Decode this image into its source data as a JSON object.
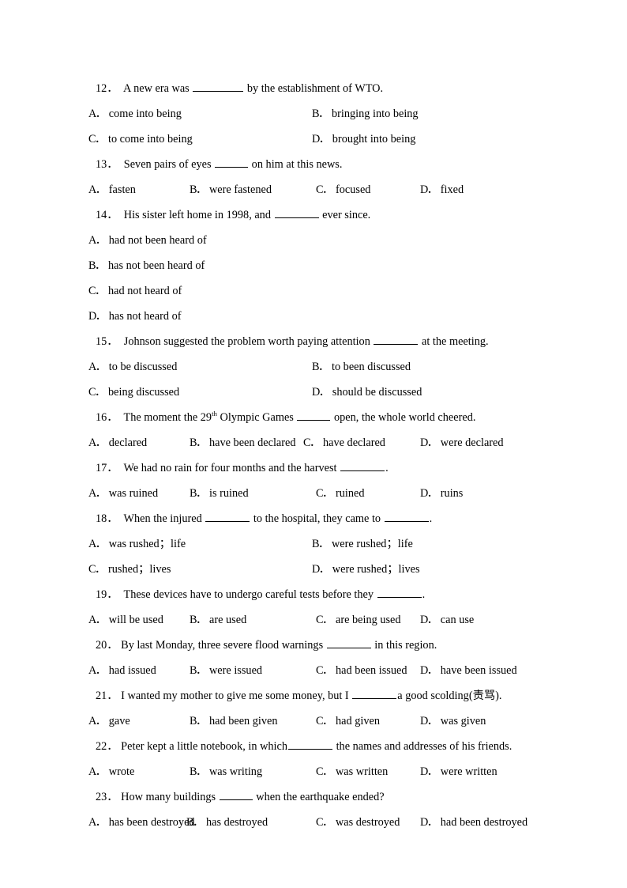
{
  "document": {
    "type": "english-grammar-worksheet",
    "page_background": "#ffffff",
    "text_color": "#000000"
  },
  "questions": [
    {
      "number": "12．",
      "stem_before": "A new era was ",
      "blank": "lg",
      "stem_after": " by the establishment of WTO.",
      "layout": "two",
      "options": [
        {
          "letter": "A．",
          "text": "come into being"
        },
        {
          "letter": "B．",
          "text": "bringing into being"
        },
        {
          "letter": "C．",
          "text": "to come into being"
        },
        {
          "letter": "D．",
          "text": "brought into being"
        }
      ]
    },
    {
      "number": "13．",
      "stem_before": "Seven pairs of eyes ",
      "blank": "sm",
      "stem_after": " on him at this news.",
      "layout": "four",
      "options": [
        {
          "letter": "A．",
          "text": "fasten"
        },
        {
          "letter": "B．",
          "text": "were fastened"
        },
        {
          "letter": "C．",
          "text": "focused"
        },
        {
          "letter": "D．",
          "text": "fixed"
        }
      ]
    },
    {
      "number": "14．",
      "stem_before": "His sister left home in 1998, and ",
      "blank": "md",
      "stem_after": " ever since.",
      "layout": "one",
      "options": [
        {
          "letter": "A．",
          "text": "had not been heard of"
        },
        {
          "letter": "B．",
          "text": "has not been heard of"
        },
        {
          "letter": "C．",
          "text": "had not heard of"
        },
        {
          "letter": "D．",
          "text": "has not heard of"
        }
      ]
    },
    {
      "number": "15．",
      "stem_before": "Johnson suggested the problem worth paying attention ",
      "blank": "md",
      "stem_after": " at the meeting.",
      "layout": "two",
      "options": [
        {
          "letter": "A．",
          "text": "to be discussed"
        },
        {
          "letter": "B．",
          "text": "to been discussed"
        },
        {
          "letter": "C．",
          "text": "being discussed"
        },
        {
          "letter": "D．",
          "text": "should be discussed"
        }
      ]
    },
    {
      "number": "16．",
      "stem_before": "The moment the 29",
      "superscript": "th",
      "stem_mid": " Olympic Games ",
      "blank": "sm",
      "stem_after": " open, the whole world cheered.",
      "layout": "four",
      "options": [
        {
          "letter": "A．",
          "text": "declared"
        },
        {
          "letter": "B．",
          "text": "have been declared"
        },
        {
          "letter": "C．",
          "text": "have declared"
        },
        {
          "letter": "D．",
          "text": "were declared"
        }
      ]
    },
    {
      "number": "17．",
      "stem_before": "We had no rain for four months and the harvest ",
      "blank": "md",
      "stem_after": ".",
      "layout": "four",
      "options": [
        {
          "letter": "A．",
          "text": "was ruined"
        },
        {
          "letter": "B．",
          "text": "is ruined"
        },
        {
          "letter": "C．",
          "text": "ruined"
        },
        {
          "letter": "D．",
          "text": "ruins"
        }
      ]
    },
    {
      "number": "18．",
      "stem_before": "When the injured ",
      "blank": "md",
      "stem_after": " to the hospital, they came to ",
      "blank2": "md",
      "stem_end": ".",
      "layout": "two",
      "options": [
        {
          "letter": "A．",
          "text": "was rushed；life"
        },
        {
          "letter": "B．",
          "text": "were rushed；life"
        },
        {
          "letter": "C．",
          "text": "rushed；lives"
        },
        {
          "letter": "D．",
          "text": "were rushed；lives"
        }
      ]
    },
    {
      "number": "19．",
      "stem_before": "These devices have to undergo careful tests before they ",
      "blank": "md",
      "stem_after": ".",
      "layout": "four",
      "options": [
        {
          "letter": "A．",
          "text": "will be used"
        },
        {
          "letter": "B．",
          "text": "are used"
        },
        {
          "letter": "C．",
          "text": "are being used"
        },
        {
          "letter": "D．",
          "text": "can use"
        }
      ]
    },
    {
      "number": "20．",
      "stem_before": "By last Monday, three severe flood warnings ",
      "blank": "md",
      "stem_after": " in this region.",
      "layout": "four",
      "options": [
        {
          "letter": "A．",
          "text": "had issued"
        },
        {
          "letter": "B．",
          "text": "were issued"
        },
        {
          "letter": "C．",
          "text": "had been issued"
        },
        {
          "letter": "D．",
          "text": "have been issued"
        }
      ]
    },
    {
      "number": "21．",
      "stem_before": "I wanted my mother to give me some money, but I",
      "blank": "md",
      "stem_after": "a good scolding(责骂).",
      "layout": "four",
      "options": [
        {
          "letter": "A．",
          "text": "gave"
        },
        {
          "letter": "B．",
          "text": "had been given"
        },
        {
          "letter": "C．",
          "text": "had given"
        },
        {
          "letter": "D．",
          "text": "was given"
        }
      ]
    },
    {
      "number": "22．",
      "stem_before": "Peter kept a little notebook, in which",
      "blank": "md",
      "stem_after": " the names and addresses of his friends.",
      "layout": "four",
      "options": [
        {
          "letter": "A．",
          "text": "wrote"
        },
        {
          "letter": "B．",
          "text": "was writing"
        },
        {
          "letter": "C．",
          "text": "was written"
        },
        {
          "letter": "D．",
          "text": "were written"
        }
      ]
    },
    {
      "number": "23．",
      "stem_before": "How many buildings ",
      "blank": "sm",
      "stem_after": " when the earthquake ended?",
      "layout": "four-tight",
      "options": [
        {
          "letter": "A．",
          "text": "has been destroyed"
        },
        {
          "letter": "B．",
          "text": "has destroyed"
        },
        {
          "letter": "C．",
          "text": "was destroyed"
        },
        {
          "letter": "D．",
          "text": "had been destroyed"
        }
      ]
    }
  ]
}
